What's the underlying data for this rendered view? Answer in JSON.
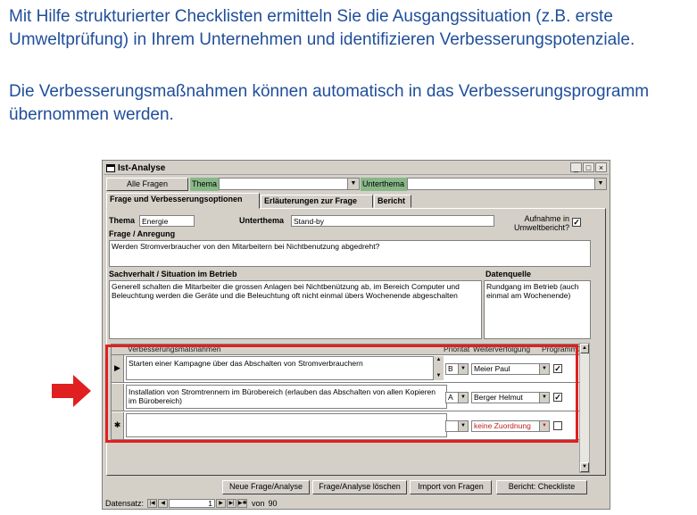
{
  "intro": {
    "paragraph1": "Mit Hilfe strukturierter Checklisten ermitteln Sie die Ausgangssituation (z.B. erste Umweltprüfung) in Ihrem Unternehmen und identifizieren Verbesserungspotenziale.",
    "paragraph2": "Die Verbesserungsmaßnahmen können automatisch in das Verbesserungsprogramm übernommen werden."
  },
  "colors": {
    "intro_text": "#1f4e9a",
    "highlight": "#e02020",
    "arrow": "#e02020",
    "label_green": "#88b888"
  },
  "window": {
    "title": "Ist-Analyse",
    "controls": {
      "minimize": "_",
      "maximize": "□",
      "close": "×"
    }
  },
  "toolbar": {
    "all_questions": "Alle Fragen",
    "thema_label": "Thema",
    "unterthema_label": "Unterthema"
  },
  "tabs": [
    {
      "label": "Frage und Verbesserungsoptionen",
      "active": true
    },
    {
      "label": "Erläuterungen zur Frage",
      "active": false
    },
    {
      "label": "Bericht",
      "active": false
    }
  ],
  "form": {
    "thema_label": "Thema",
    "thema_value": "Energie",
    "unterthema_label": "Unterthema",
    "unterthema_value": "Stand-by",
    "aufnahme_label": "Aufnahme in Umweltbericht?",
    "aufnahme_checked": "✓",
    "frage_label": "Frage / Anregung",
    "frage_value": "Werden Stromverbraucher von den Mitarbeitern bei Nichtbenutzung abgedreht?",
    "sachverhalt_label": "Sachverhalt / Situation im Betrieb",
    "sachverhalt_value": "Generell schalten die Mitarbeiter die grossen Anlagen bei Nichtbenützung ab, im Bereich Computer und Beleuchtung werden die Geräte und die Beleuchtung oft nicht einmal übers Wochenende abgeschalten",
    "datenquelle_label": "Datenquelle",
    "datenquelle_value": "Rundgang im Betrieb (auch einmal am Wochenende)"
  },
  "subform": {
    "headers": {
      "massnahmen": "Verbesserungsmaßnahmen",
      "prioritaet": "Priorität",
      "weiterverfolgung": "Weiterverfolgung",
      "programm": "Programm?"
    },
    "rows": [
      {
        "selector": "▶",
        "text": "Starten einer Kampagne über das Abschalten von Stromverbrauchern",
        "priority": "B",
        "person": "Meier Paul",
        "checked": "✓"
      },
      {
        "selector": "",
        "text": "Installation von Stromtrennern im Bürobereich (erlauben das Abschalten von allen Kopieren im Bürobereich)",
        "priority": "A",
        "person": "Berger Helmut",
        "checked": "✓"
      },
      {
        "selector": "✱",
        "text": "",
        "priority": "",
        "person": "keine Zuordnung",
        "checked": ""
      }
    ]
  },
  "buttons": {
    "neue_frage": "Neue Frage/Analyse",
    "loeschen": "Frage/Analyse löschen",
    "import": "Import von Fragen",
    "bericht": "Bericht: Checkliste"
  },
  "navigation": {
    "label": "Datensatz:",
    "current": "1",
    "of_label": "von",
    "total": "90"
  }
}
